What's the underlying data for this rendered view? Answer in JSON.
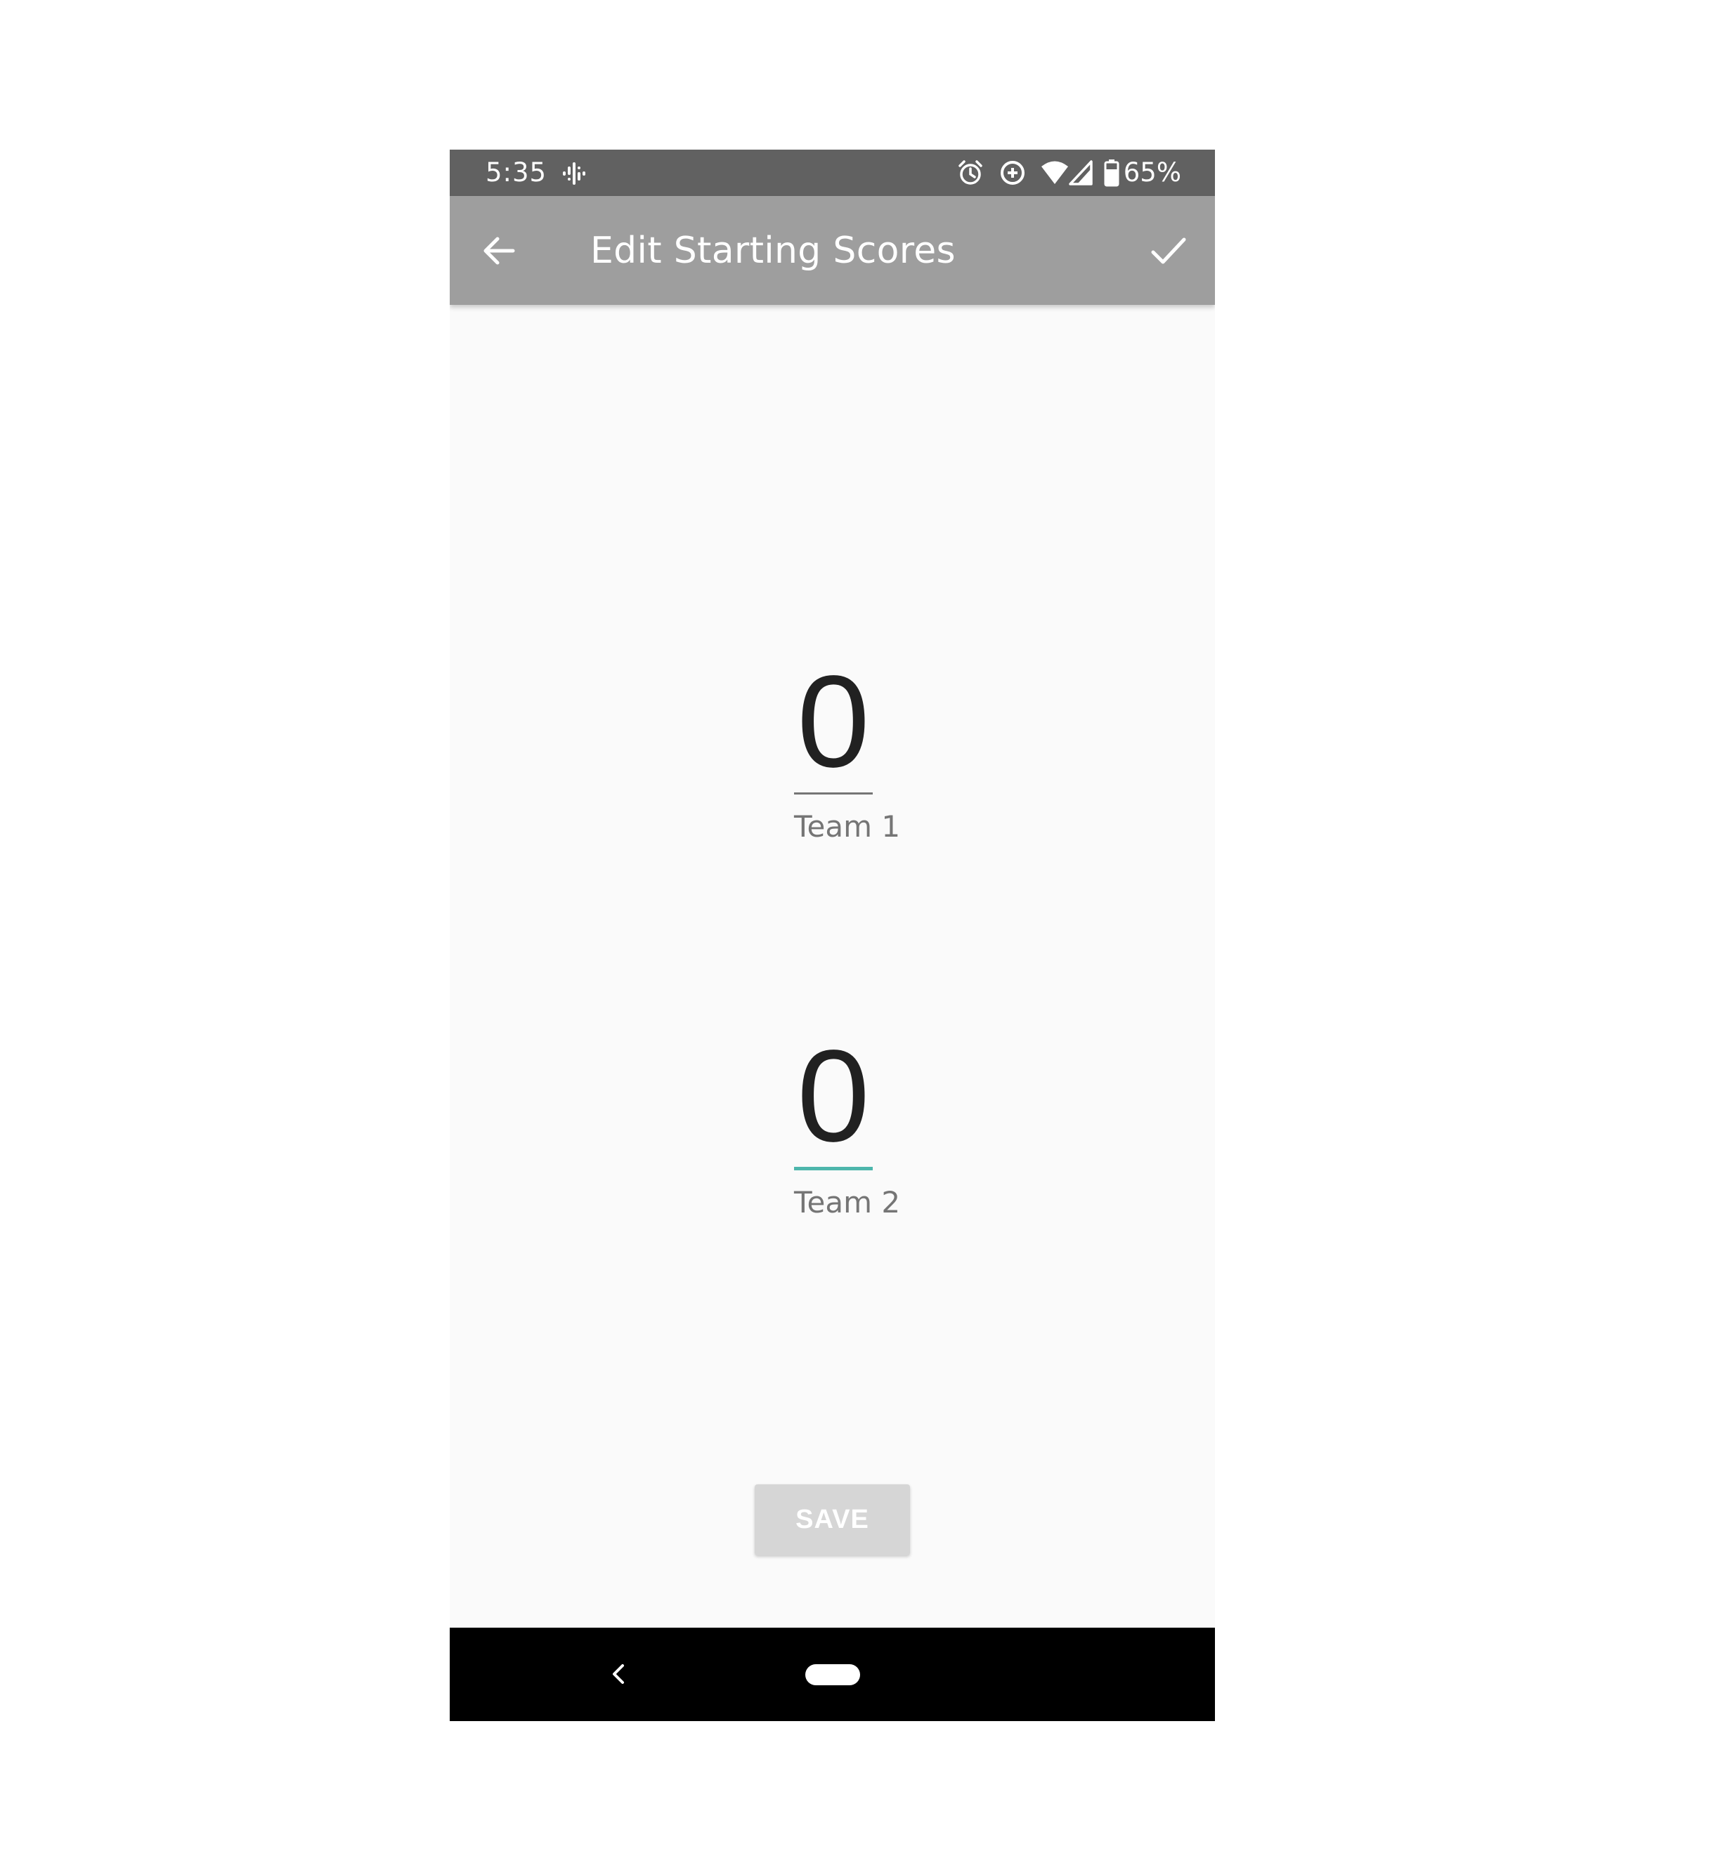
{
  "status_bar": {
    "time": "5:35",
    "battery_percent": "65%",
    "icons": [
      "podcast-icon",
      "alarm-icon",
      "data-saver-icon",
      "wifi-icon",
      "signal-icon",
      "battery-icon"
    ]
  },
  "app_bar": {
    "title": "Edit Starting Scores",
    "back_icon": "arrow-left-icon",
    "done_icon": "check-icon",
    "color": "#9e9e9e"
  },
  "scores": [
    {
      "label": "Team 1",
      "value": "0",
      "focused": false
    },
    {
      "label": "Team 2",
      "value": "0",
      "focused": true
    }
  ],
  "save_button": {
    "label": "SAVE",
    "enabled": false
  },
  "nav_bar": {
    "icons": [
      "nav-back-icon",
      "nav-home-pill"
    ]
  },
  "colors": {
    "accent": "#4db6ac",
    "status_bar": "#616161",
    "background": "#fafafa"
  }
}
